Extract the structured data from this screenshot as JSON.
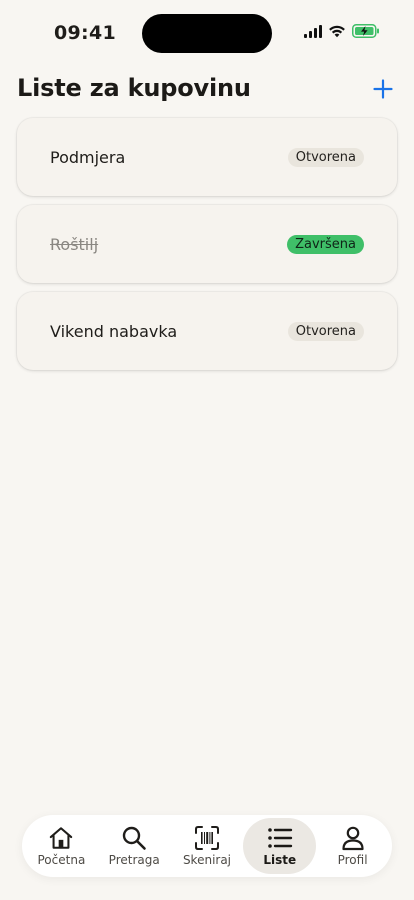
{
  "status_bar": {
    "time": "09:41",
    "icons": [
      "signal-icon",
      "wifi-icon",
      "battery-charging-icon"
    ],
    "battery_color": "#3fbf68"
  },
  "header": {
    "title": "Liste za kupovinu",
    "add_icon": "plus-icon",
    "accent_color": "#1a73e8"
  },
  "lists": [
    {
      "name": "Podmjera",
      "status": "Otvorena",
      "completed": false
    },
    {
      "name": "Roštilj",
      "status": "Završena",
      "completed": true
    },
    {
      "name": "Vikend nabavka",
      "status": "Otvorena",
      "completed": false
    }
  ],
  "tabs": [
    {
      "label": "Početna",
      "icon": "home-icon",
      "active": false
    },
    {
      "label": "Pretraga",
      "icon": "search-icon",
      "active": false
    },
    {
      "label": "Skeniraj",
      "icon": "barcode-scan-icon",
      "active": false
    },
    {
      "label": "Liste",
      "icon": "list-icon",
      "active": true
    },
    {
      "label": "Profil",
      "icon": "profile-icon",
      "active": false
    }
  ],
  "colors": {
    "background": "#f8f6f2",
    "status_done": "#3fbf68",
    "status_open": "#e9e5dd"
  }
}
